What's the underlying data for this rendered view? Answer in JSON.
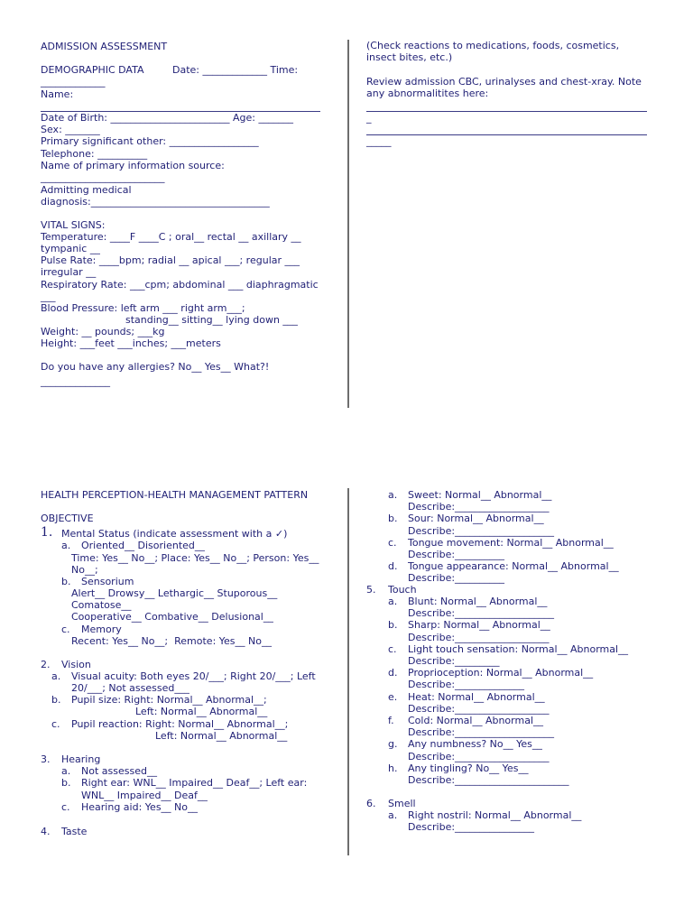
{
  "page_top": {
    "left": {
      "title": "ADMISSION ASSESSMENT",
      "demographic": {
        "heading": "DEMOGRAPHIC DATA",
        "date_line": "Date: _____________ Time:",
        "time_cont": "_____________",
        "name": "Name:",
        "name_rule": "________________________________________",
        "dob": "Date of Birth: ________________________ Age: _______",
        "sex": "Sex: _______",
        "significant_other": "Primary significant other: __________________",
        "telephone": "Telephone: __________",
        "info_source": "Name of primary information source:",
        "info_source_rule": "_________________________",
        "admitting_1": "Admitting medical",
        "admitting_2": "diagnosis:____________________________________"
      },
      "vital_signs": {
        "heading": "VITAL SIGNS:",
        "temperature": "Temperature: ____F ____C ; oral__ rectal __ axillary __",
        "temperature_cont": "tympanic __",
        "pulse": "Pulse Rate: ____bpm; radial __ apical ___; regular ___",
        "pulse_cont": "irregular __",
        "respiratory": "Respiratory Rate: ___cpm; abdominal ___ diaphragmatic",
        "respiratory_cont": "___",
        "bp": "Blood Pressure: left arm ___ right arm___;",
        "bp_cont": "standing__ sitting__ lying down ___",
        "weight": "Weight: __ pounds; ___kg",
        "height": "Height: ___feet ___inches; ___meters"
      },
      "allergies": "Do you have any allergies? No__ Yes__ What?!",
      "allergies_rule": "______________"
    },
    "right": {
      "check_1": "(Check reactions to medications, foods, cosmetics,",
      "check_2": "insect bites, etc.)",
      "review_1": "Review admission CBC, urinalyses and chest-xray. Note",
      "review_2": "any abnormalitites here:",
      "rule_short_1": "_",
      "rule_short_2": "_____"
    }
  },
  "page_bottom": {
    "left": {
      "title": "HEALTH PERCEPTION-HEALTH MANAGEMENT PATTERN",
      "objective": "OBJECTIVE",
      "items": [
        {
          "num": "1.",
          "label": "Mental Status (indicate assessment with a ✓)"
        },
        {
          "num": "2.",
          "label": "Vision"
        },
        {
          "num": "3.",
          "label": "Hearing"
        },
        {
          "num": "4.",
          "label": "Taste"
        }
      ],
      "mental": {
        "a_letter": "a.",
        "a_label": "Oriented__ Disoriented__",
        "a_line2": "Time: Yes__ No__; Place: Yes__ No__; Person: Yes__",
        "a_line3": "No__;",
        "b_letter": "b.",
        "b_label": "Sensorium",
        "b_line2": "Alert__ Drowsy__ Lethargic__ Stuporous__",
        "b_line3": "Comatose__",
        "b_line4": "Cooperative__ Combative__ Delusional__",
        "c_letter": "c.",
        "c_label": "Memory",
        "c_line2": "Recent: Yes__ No__;  Remote: Yes__ No__"
      },
      "vision": {
        "a_letter": "a.",
        "a_label": "Visual acuity: Both eyes 20/___; Right 20/___; Left",
        "a_line2": "20/___; Not assessed___",
        "b_letter": "b.",
        "b_label": "Pupil size: Right: Normal__ Abnormal__;",
        "b_line2": "Left: Normal__ Abnormal__",
        "c_letter": "c.",
        "c_label": "Pupil reaction: Right: Normal__ Abnormal__;",
        "c_line2": "Left: Normal__ Abnormal__"
      },
      "hearing": {
        "a_letter": "a.",
        "a_label": "Not assessed__",
        "b_letter": "b.",
        "b_label": "Right ear: WNL__ Impaired__ Deaf__; Left ear:",
        "b_line2": "WNL__ Impaired__ Deaf__",
        "c_letter": "c.",
        "c_label": "Hearing aid: Yes__ No__"
      }
    },
    "right": {
      "taste": [
        {
          "letter": "a.",
          "label": "Sweet: Normal__ Abnormal__",
          "describe": "Describe:___________________"
        },
        {
          "letter": "b.",
          "label": "Sour: Normal__ Abnormal__",
          "describe": "Describe:____________________"
        },
        {
          "letter": "c.",
          "label": "Tongue movement: Normal__ Abnormal__",
          "describe": "Describe:__________"
        },
        {
          "letter": "d.",
          "label": "Tongue appearance: Normal__ Abnormal__",
          "describe": "Describe:__________"
        }
      ],
      "touch_num": "5.",
      "touch_label": "Touch",
      "touch": [
        {
          "letter": "a.",
          "label": "Blunt: Normal__ Abnormal__",
          "describe": "Describe:____________________"
        },
        {
          "letter": "b.",
          "label": "Sharp: Normal__ Abnormal__",
          "describe": "Describe:___________________"
        },
        {
          "letter": "c.",
          "label": "Light touch sensation: Normal__ Abnormal__",
          "describe": "Describe:_________"
        },
        {
          "letter": "d.",
          "label": "Proprioception: Normal__ Abnormal__",
          "describe": "Describe:______________"
        },
        {
          "letter": "e.",
          "label": "Heat: Normal__ Abnormal__",
          "describe": "Describe:___________________"
        },
        {
          "letter": "f.",
          "label": "Cold: Normal__ Abnormal__",
          "describe": "Describe:____________________"
        },
        {
          "letter": "g.",
          "label": "Any numbness? No__ Yes__",
          "describe": "Describe:___________________"
        },
        {
          "letter": "h.",
          "label": "Any tingling? No__ Yes__",
          "describe": "Describe:_______________________"
        }
      ],
      "smell_num": "6.",
      "smell_label": "Smell",
      "smell": [
        {
          "letter": "a.",
          "label": "Right nostril: Normal__ Abnormal__",
          "describe": "Describe:________________"
        }
      ]
    }
  }
}
